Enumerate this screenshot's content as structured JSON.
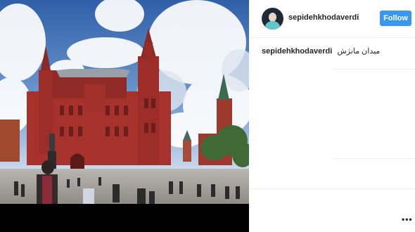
{
  "post": {
    "username": "sepidehkhodaverdi",
    "follow_label": "Follow",
    "caption_user": "sepidehkhodaverdi",
    "caption_text": "میدان مانژش",
    "more_label": "•••"
  },
  "colors": {
    "follow_button": "#3897f0",
    "text": "#262626",
    "divider": "#efefef"
  },
  "icons": {
    "more": "more-options-icon"
  }
}
